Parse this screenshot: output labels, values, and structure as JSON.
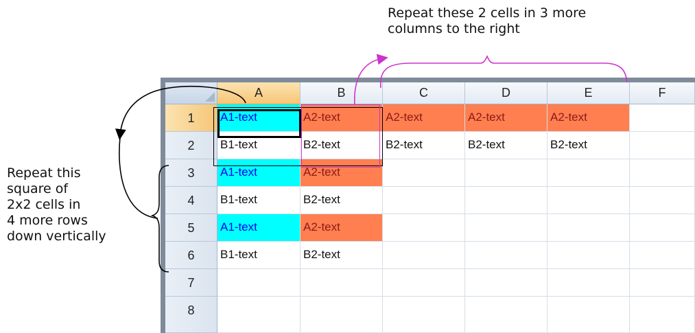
{
  "annotations": {
    "top_note": "Repeat these 2 cells in 3 more\ncolumns to the right",
    "left_note": "Repeat this\nsquare of\n2x2 cells in\n4 more rows\ndown vertically"
  },
  "spreadsheet": {
    "columns": [
      "A",
      "B",
      "C",
      "D",
      "E",
      "F"
    ],
    "selected_column": "A",
    "rows": [
      "1",
      "2",
      "3",
      "4",
      "5",
      "6",
      "7",
      "8"
    ],
    "selected_row": "1",
    "cells": {
      "r1": [
        "A1-text",
        "A2-text",
        "A2-text",
        "A2-text",
        "A2-text",
        ""
      ],
      "r2": [
        "B1-text",
        "B2-text",
        "B2-text",
        "B2-text",
        "B2-text",
        ""
      ],
      "r3": [
        "A1-text",
        "A2-text",
        "",
        "",
        "",
        ""
      ],
      "r4": [
        "B1-text",
        "B2-text",
        "",
        "",
        "",
        ""
      ],
      "r5": [
        "A1-text",
        "A2-text",
        "",
        "",
        "",
        ""
      ],
      "r6": [
        "B1-text",
        "B2-text",
        "",
        "",
        "",
        ""
      ],
      "r7": [
        "",
        "",
        "",
        "",
        "",
        ""
      ],
      "r8": [
        "",
        "",
        "",
        "",
        "",
        ""
      ]
    }
  },
  "colors": {
    "cyan_fill": "#00ffff",
    "orange_fill": "#ff7f50",
    "selection_header": "#f6c678",
    "annotation_magenta": "#cc33cc",
    "annotation_black": "#000000"
  }
}
